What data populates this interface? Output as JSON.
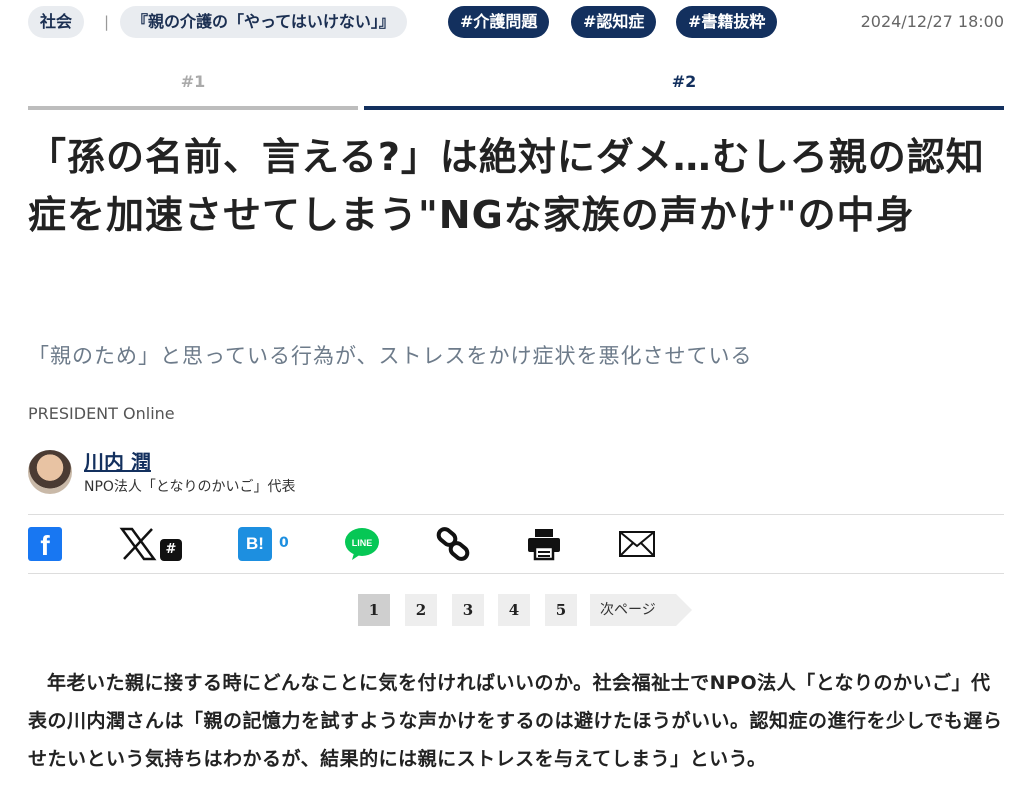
{
  "tags": {
    "category": "社会",
    "series": "『親の介護の「やってはいけない」』",
    "hashtags": [
      "#介護問題",
      "#認知症",
      "#書籍抜粋"
    ],
    "date": "2024/12/27 18:00"
  },
  "tabs": [
    "#1",
    "#2"
  ],
  "article": {
    "title": "「孫の名前、言える?」は絶対にダメ…むしろ親の認知症を加速させてしまう\"NGな家族の声かけ\"の中身",
    "subtitle": "「親のため」と思っている行為が、ストレスをかけ症状を悪化させている",
    "source": "PRESIDENT Online",
    "author_name": "川内 潤",
    "author_role": "NPO法人「となりのかいご」代表",
    "body": "年老いた親に接する時にどんなことに気を付ければいいのか。社会福祉士でNPO法人「となりのかいご」代表の川内潤さんは「親の記憶力を試すような声かけをするのは避けたほうがいい。認知症の進行を少しでも遅らせたいという気持ちはわかるが、結果的には親にストレスを与えてしまう」という。"
  },
  "share": {
    "hatena_label": "B!",
    "hatena_count": "0",
    "x_hash": "#"
  },
  "pager": {
    "pages": [
      "1",
      "2",
      "3",
      "4",
      "5"
    ],
    "current": "1",
    "next_label": "次ページ"
  },
  "icons": [
    "facebook-icon",
    "x-icon",
    "hatena-bookmark-icon",
    "line-icon",
    "link-icon",
    "print-icon",
    "mail-icon"
  ],
  "colors": {
    "navy": "#13305e",
    "facebook": "#1877f2",
    "hatena": "#1d8fe0",
    "line": "#06c755"
  }
}
